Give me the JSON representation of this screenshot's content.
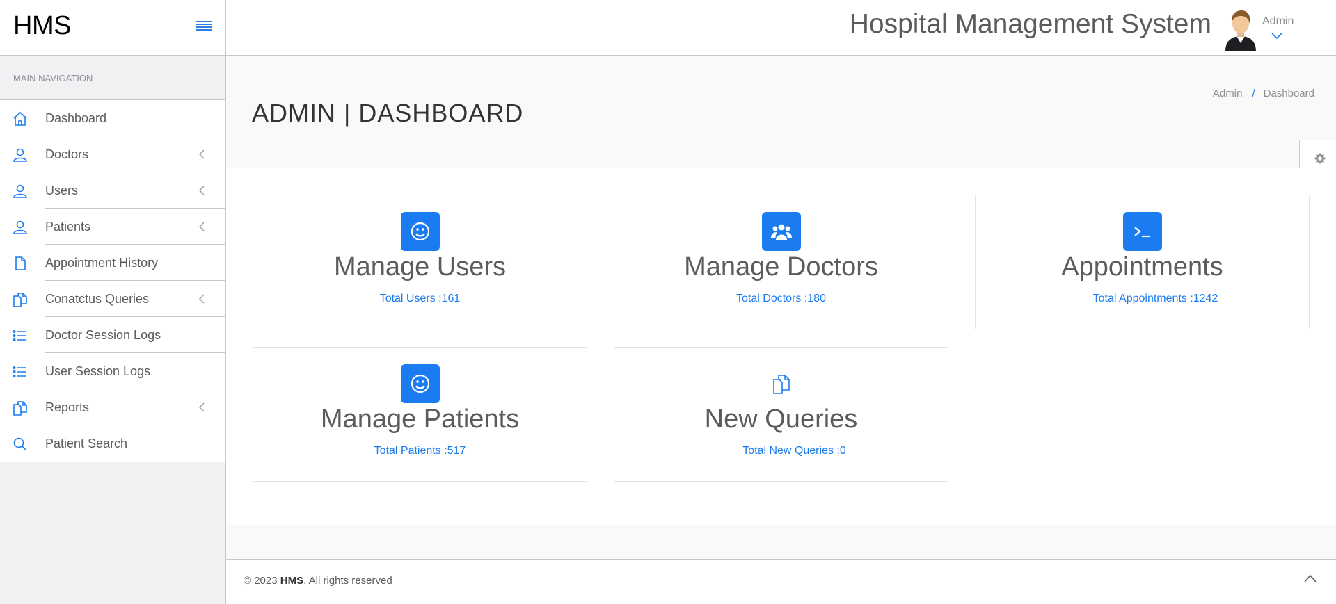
{
  "brand": "HMS",
  "header": {
    "system_title": "Hospital Management System",
    "user_name": "Admin"
  },
  "sidebar": {
    "section_title": "Main Navigation",
    "items": [
      {
        "label": "Dashboard",
        "icon": "home-icon",
        "submenu": false
      },
      {
        "label": "Doctors",
        "icon": "user-icon",
        "submenu": true
      },
      {
        "label": "Users",
        "icon": "user-icon",
        "submenu": true
      },
      {
        "label": "Patients",
        "icon": "user-icon",
        "submenu": true
      },
      {
        "label": "Appointment History",
        "icon": "file-icon",
        "submenu": false
      },
      {
        "label": "Conatctus Queries",
        "icon": "files-icon",
        "submenu": true
      },
      {
        "label": "Doctor Session Logs",
        "icon": "list-icon",
        "submenu": false
      },
      {
        "label": "User Session Logs",
        "icon": "list-icon",
        "submenu": false
      },
      {
        "label": "Reports",
        "icon": "files-icon",
        "submenu": true
      },
      {
        "label": "Patient Search",
        "icon": "search-icon",
        "submenu": false
      }
    ]
  },
  "page": {
    "title": "ADMIN | DASHBOARD",
    "breadcrumb": [
      "Admin",
      "Dashboard"
    ],
    "breadcrumb_separator": "/"
  },
  "cards": [
    {
      "title": "Manage Users",
      "stat": "Total Users :161",
      "icon": "smile-icon"
    },
    {
      "title": "Manage Doctors",
      "stat": "Total Doctors :180",
      "icon": "users-group-icon"
    },
    {
      "title": "Appointments",
      "stat": "Total Appointments :1242",
      "icon": "terminal-icon"
    },
    {
      "title": "Manage Patients",
      "stat": "Total Patients :517",
      "icon": "smile-icon"
    },
    {
      "title": "New Queries",
      "stat": "Total New Queries :0",
      "icon": "files-icon"
    }
  ],
  "footer": {
    "copyright_prefix": "© 2023 ",
    "copyright_brand": "HMS",
    "copyright_suffix": ". All rights reserved"
  },
  "colors": {
    "accent": "#1a7cf0",
    "sidebar_bg": "#f1f1f4",
    "text": "#5b5b60"
  }
}
